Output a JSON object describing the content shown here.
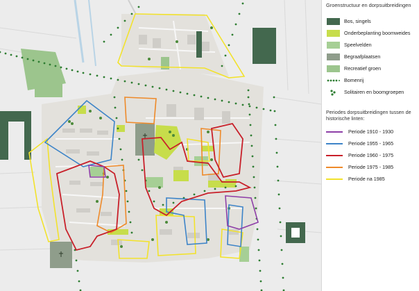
{
  "legend": {
    "title": "Groenstructuur en dorpsuitbreidingen",
    "green_items": [
      {
        "label": "Bos, singels",
        "color": "#43684e",
        "kind": "fill"
      },
      {
        "label": "Onderbeplanting boomweides",
        "color": "#c7dd4b",
        "kind": "fill"
      },
      {
        "label": "Speelvelden",
        "color": "#a6cf95",
        "kind": "fill"
      },
      {
        "label": "Begraafplaatsen",
        "color": "#8f9d8b",
        "kind": "fill"
      },
      {
        "label": "Recreatief groen",
        "color": "#9cc58d",
        "kind": "fill"
      },
      {
        "label": "Bomenrij",
        "color": "#2e7d32",
        "kind": "dots-row"
      },
      {
        "label": "Solitairen en boomgroepen",
        "color": "#2e7d32",
        "kind": "dots-group"
      }
    ],
    "periods_title": "Periodes dorpsuitbreidingen tussen de historische linten:",
    "periods": [
      {
        "label": "Periode 1910 - 1930",
        "color": "#8e3fa8"
      },
      {
        "label": "Periode 1955 - 1965",
        "color": "#3d84c8"
      },
      {
        "label": "Periode 1960 - 1975",
        "color": "#c8202a"
      },
      {
        "label": "Periode 1975 - 1985",
        "color": "#ee8a2a"
      },
      {
        "label": "Periode na 1985",
        "color": "#f2e22c"
      }
    ]
  }
}
